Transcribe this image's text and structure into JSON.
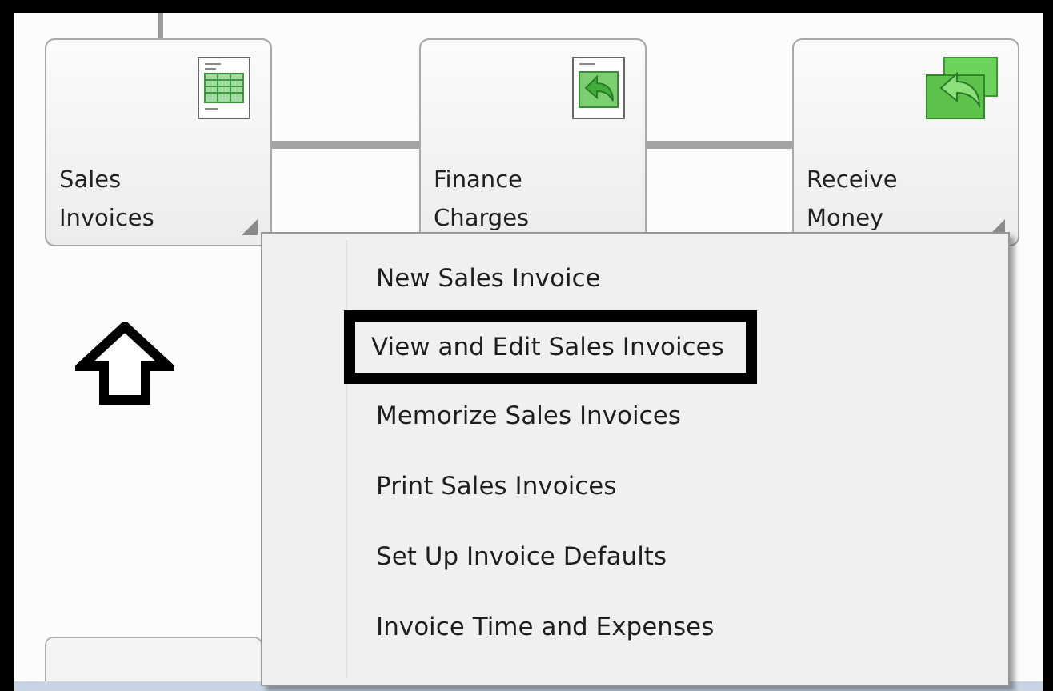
{
  "tiles": [
    {
      "kind": "invoice",
      "label": [
        "Sales",
        "Invoices"
      ],
      "has_menu": true
    },
    {
      "kind": "finance",
      "label": [
        "Finance",
        "Charges"
      ],
      "has_menu": false
    },
    {
      "kind": "money",
      "label": [
        "Receive",
        "Money"
      ],
      "has_menu": true
    }
  ],
  "menu": {
    "items": [
      {
        "label": "New Sales Invoice",
        "selected": false
      },
      {
        "label": "View and Edit Sales Invoices",
        "selected": true
      },
      {
        "label": "Memorize Sales Invoices",
        "selected": false
      },
      {
        "label": "Print Sales Invoices",
        "selected": false
      },
      {
        "label": "Set Up Invoice Defaults",
        "selected": false
      },
      {
        "label": "Invoice Time and Expenses",
        "selected": false
      }
    ]
  }
}
